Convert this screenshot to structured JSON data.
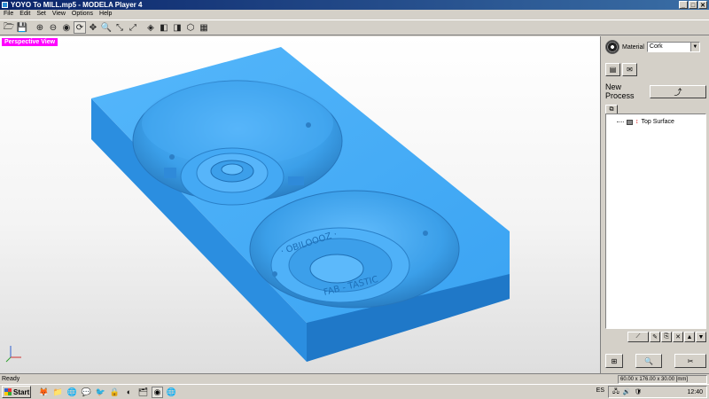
{
  "window": {
    "title": "YOYO To MILL.mp5 - MODELA Player 4",
    "min": "_",
    "max": "□",
    "close": "✕"
  },
  "menu": [
    "File",
    "Edit",
    "Set",
    "View",
    "Options",
    "Help"
  ],
  "toolbar": {
    "icons": [
      "open-folder-icon",
      "save-icon",
      "zoom-window-icon",
      "pan-icon",
      "rotate-icon",
      "rotate-active-icon",
      "move-icon",
      "zoom-icon",
      "fit-icon",
      "zoom-extents-icon",
      "iso-view-icon",
      "front-view-icon",
      "side-view-icon",
      "top-view-icon",
      "grid-view-icon"
    ],
    "glyphs": [
      "🗁",
      "💾",
      "⊕",
      "⊖",
      "◉",
      "⟳",
      "✥",
      "🔍",
      "⤡",
      "⤢",
      "◈",
      "◧",
      "◨",
      "⬡",
      "▦"
    ],
    "active_index": 5
  },
  "viewport": {
    "label": "Perspective View",
    "model_color": "#3fa9f5"
  },
  "panel": {
    "material_label": "Material",
    "material_value": "Cork",
    "new_process_label": "New Process",
    "tree_item": "Top Surface"
  },
  "status": {
    "text": "Ready",
    "dims": "60.00 x 176.00 x 30.00 [mm]"
  },
  "taskbar": {
    "start": "Start",
    "lang": "ES",
    "clock": "12:40",
    "apps": [
      "🦊",
      "📁",
      "🌐",
      "💬",
      "🐦",
      "🔒",
      "◐",
      "🗂",
      "◉",
      "🌐"
    ]
  }
}
